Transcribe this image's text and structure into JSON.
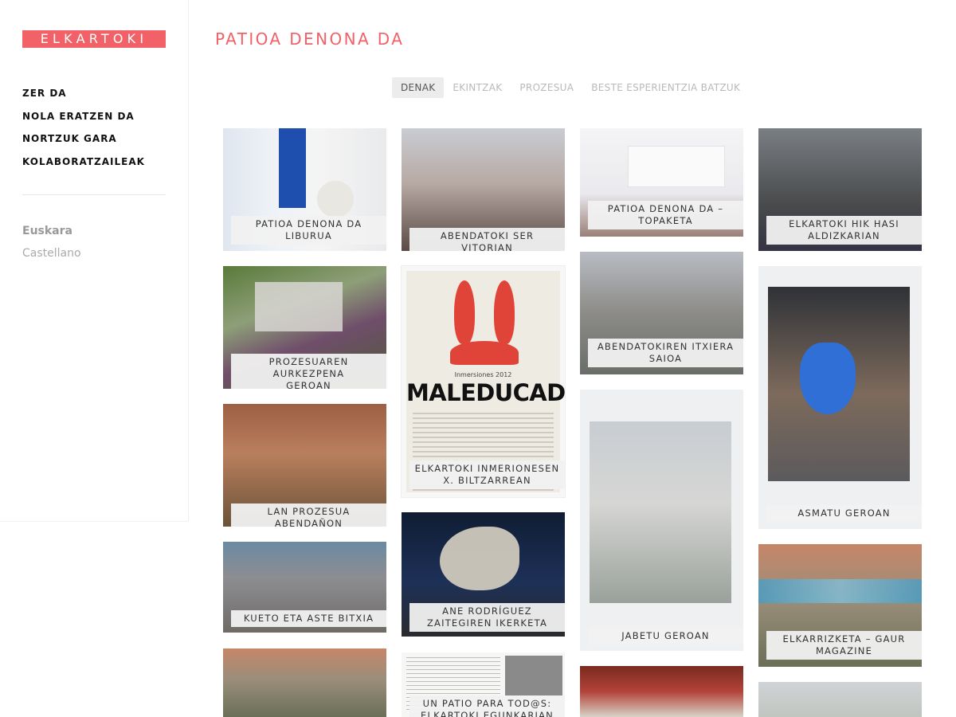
{
  "sidebar": {
    "logo": "ELKARTOKI",
    "nav": [
      {
        "label": "ZER DA"
      },
      {
        "label": "NOLA ERATZEN DA"
      },
      {
        "label": "NORTZUK GARA"
      },
      {
        "label": "KOLABORATZAILEAK"
      }
    ],
    "languages": [
      {
        "label": "Euskara",
        "active": true
      },
      {
        "label": "Castellano",
        "active": false
      }
    ]
  },
  "main": {
    "title": "PATIOA DENONA DA",
    "filters": [
      {
        "label": "DENAK",
        "active": true
      },
      {
        "label": "EKINTZAK",
        "active": false
      },
      {
        "label": "PROZESUA",
        "active": false
      },
      {
        "label": "BESTE ESPERIENTZIA BATZUK",
        "active": false
      }
    ],
    "poster": {
      "subtitle": "Inmersiones 2012",
      "title": "MALEDUCADOS"
    },
    "cards": [
      {
        "caption": "PATIOA DENONA DA\nLIBURUA"
      },
      {
        "caption": "PROZESUAREN AURKEZPENA\nGEROAN"
      },
      {
        "caption": "LAN PROZESUA ABENDAÑON"
      },
      {
        "caption": "KUETO ETA ASTE BITXIA"
      },
      {
        "caption": ""
      },
      {
        "caption": "ABENDATOKI SER VITORIAN"
      },
      {
        "caption": "ELKARTOKI INMERIONESEN\nX. BILTZARREAN"
      },
      {
        "caption": "ANE RODRÍGUEZ\nZAITEGIREN IKERKETA"
      },
      {
        "caption": "UN PATIO PARA TOD@S:\nELKARTOKI EGUNKARIAN"
      },
      {
        "caption": "PATIOA DENONA DA –\nTOPAKETA"
      },
      {
        "caption": "ABENDATOKIREN ITXIERA\nSAIOA"
      },
      {
        "caption": "JABETU GEROAN"
      },
      {
        "caption": ""
      },
      {
        "caption": "ELKARTOKI HIK HASI\nALDIZKARIAN"
      },
      {
        "caption": "ASMATU GEROAN"
      },
      {
        "caption": "ELKARRIZKETA – GAUR\nMAGAZINE"
      },
      {
        "caption": ""
      }
    ]
  }
}
